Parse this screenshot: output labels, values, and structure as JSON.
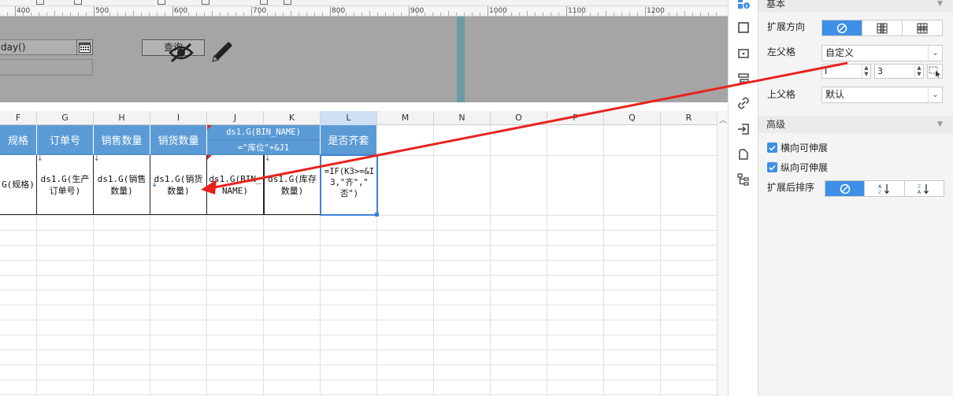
{
  "ruler": {
    "labels": [
      "400",
      "500",
      "600",
      "700",
      "800",
      "900",
      "1000",
      "1100",
      "1200"
    ]
  },
  "params": {
    "date_value": "day()",
    "query_label": "查询"
  },
  "columns": [
    "F",
    "G",
    "H",
    "I",
    "J",
    "K",
    "L",
    "M",
    "N",
    "O",
    "P",
    "Q",
    "R"
  ],
  "selected_column": "L",
  "header_cells": {
    "F": "规格",
    "G": "订单号",
    "H": "销售数量",
    "I": "销货数量",
    "J_top": "ds1.G(BIN_NAME)",
    "J_bottom": "=\"库位\"+&J1",
    "L": "是否齐套"
  },
  "data_cells": {
    "F": [
      "G(规格)"
    ],
    "G": [
      "ds1.G(生产",
      "订单号)"
    ],
    "H": [
      "ds1.G(销售",
      "数量)"
    ],
    "I": [
      "ds1.G(销货",
      "数量)"
    ],
    "J": [
      "ds1.G(BIN_",
      "NAME)"
    ],
    "K": [
      "ds1.G(库存",
      "数量)"
    ],
    "L": [
      "=IF(K3>=&I",
      "3,\"齐\",\"",
      "否\")"
    ]
  },
  "colors": {
    "header_bg": "#5b9bd5",
    "accent_blue": "#3d8fe8",
    "param_bg": "#a5a5a5",
    "annotation_red": "#e8231e"
  },
  "side_icons": [
    "cell-attribute-icon",
    "cell-style-icon",
    "widget-icon",
    "condition-attribute-icon",
    "hyperlink-icon",
    "data-entry-icon",
    "filter-icon",
    "tree-icon"
  ],
  "panel": {
    "basic_title": "基本",
    "expand_direction_label": "扩展方向",
    "left_parent_label": "左父格",
    "left_parent_value": "自定义",
    "left_col": "I",
    "left_row": "3",
    "upper_parent_label": "上父格",
    "upper_parent_value": "默认",
    "advanced_title": "高级",
    "horizontal_expand_label": "横向可伸展",
    "vertical_expand_label": "纵向可伸展",
    "sort_label": "扩展后排序",
    "horizontal_expand_checked": true,
    "vertical_expand_checked": true
  }
}
